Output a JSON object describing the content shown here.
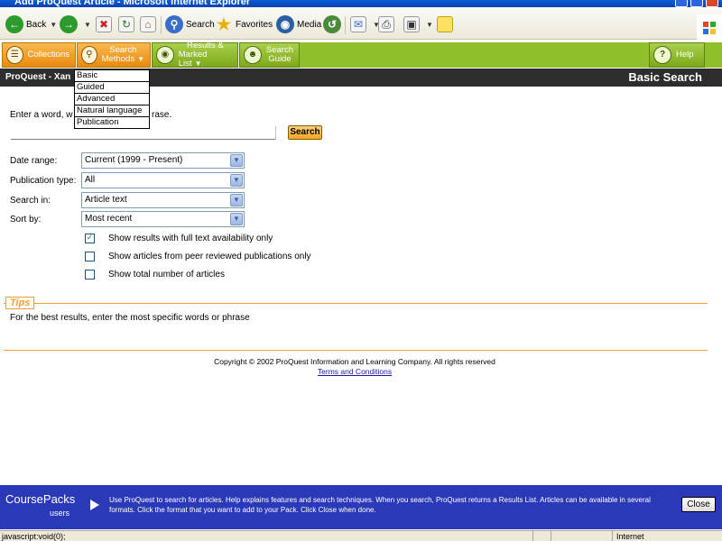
{
  "window": {
    "title": "Add ProQuest Article - Microsoft Internet Explorer"
  },
  "ie_toolbar": {
    "back": "Back",
    "search": "Search",
    "favorites": "Favorites",
    "media": "Media"
  },
  "nav": {
    "collections": "Collections",
    "search_methods_1": "Search",
    "search_methods_2": "Methods",
    "results_1": "Results &",
    "results_2": "Marked List",
    "guide_1": "Search",
    "guide_2": "Guide",
    "help": "Help"
  },
  "darkbar": {
    "left": "ProQuest - Xan",
    "right": "Basic Search"
  },
  "search_methods_menu": [
    "Basic",
    "Guided",
    "Advanced",
    "Natural language",
    "Publication"
  ],
  "form": {
    "prompt": "Enter a word, w",
    "prompt_tail": "rase.",
    "search_button": "Search",
    "date_range_label": "Date range:",
    "date_range_value": "Current (1999 - Present)",
    "pub_type_label": "Publication type:",
    "pub_type_value": "All",
    "search_in_label": "Search in:",
    "search_in_value": "Article text",
    "sort_label": "Sort by:",
    "sort_value": "Most recent",
    "cb1": "Show results with full text availability only",
    "cb2": "Show articles from peer reviewed publications only",
    "cb3": "Show total number of articles"
  },
  "checkboxes": {
    "cb1_checked": true,
    "cb2_checked": false,
    "cb3_checked": false
  },
  "tips": {
    "label": "Tips",
    "text": "For the best results, enter the most specific words or phrase"
  },
  "footer": {
    "copyright": "Copyright © 2002 ProQuest Information and Learning Company. All rights reserved",
    "terms": "Terms and Conditions"
  },
  "coursepacks": {
    "title": "CoursePacks",
    "subtitle": "users",
    "message": "Use ProQuest to search for articles. Help explains features and search techniques. When you search, ProQuest returns a Results List. Articles can be available in several formats. Click the format that you want to add to your Pack. Click Close when done.",
    "close": "Close"
  },
  "statusbar": {
    "left": "javascript:void(0);",
    "right": "Internet"
  },
  "colors": {
    "orange": "#f5a623",
    "green": "#8fbf2a",
    "dark": "#2d2d2d",
    "course_blue": "#2a39b8",
    "tips_orange": "#f0a030"
  }
}
